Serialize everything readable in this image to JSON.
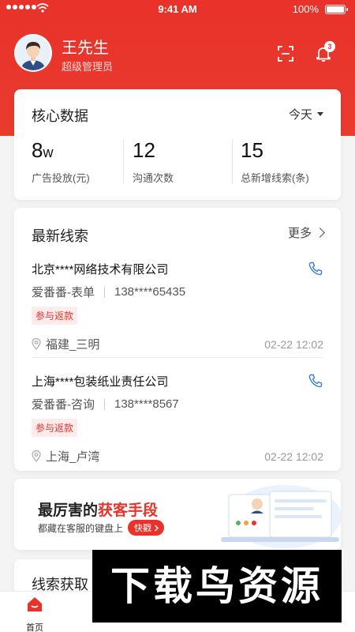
{
  "status_bar": {
    "time": "9:41 AM",
    "battery": "100%"
  },
  "user": {
    "name": "王先生",
    "role": "超级管理员",
    "notification_count": "3"
  },
  "core_data": {
    "title": "核心数据",
    "range": "今天",
    "stats": [
      {
        "value": "8",
        "unit": "w",
        "label": "广告投放(元)"
      },
      {
        "value": "12",
        "unit": "",
        "label": "沟通次数"
      },
      {
        "value": "15",
        "unit": "",
        "label": "总新增线索(条)"
      }
    ]
  },
  "leads": {
    "title": "最新线索",
    "more": "更多",
    "items": [
      {
        "company": "北京****网络技术有限公司",
        "source": "爱番番-表单",
        "phone": "138****65435",
        "tag": "参与返款",
        "location": "福建_三明",
        "date": "02-22 12:02"
      },
      {
        "company": "上海****包装纸业责任公司",
        "source": "爱番番-咨询",
        "phone": "138****8567",
        "tag": "参与返款",
        "location": "上海_卢湾",
        "date": "02-22 12:02"
      }
    ]
  },
  "promo": {
    "title_prefix": "最厉害的",
    "title_highlight": "获客手段",
    "subtitle": "都藏在客服的键盘上",
    "button": "快戳"
  },
  "next_section": {
    "title": "线索获取"
  },
  "tabbar": {
    "items": [
      {
        "label": "首页",
        "active": true
      }
    ]
  },
  "watermark": "下载鸟资源",
  "colors": {
    "brand_red": "#e8322a",
    "background": "#f4f4f4",
    "phone_blue": "#3b7bd8"
  }
}
